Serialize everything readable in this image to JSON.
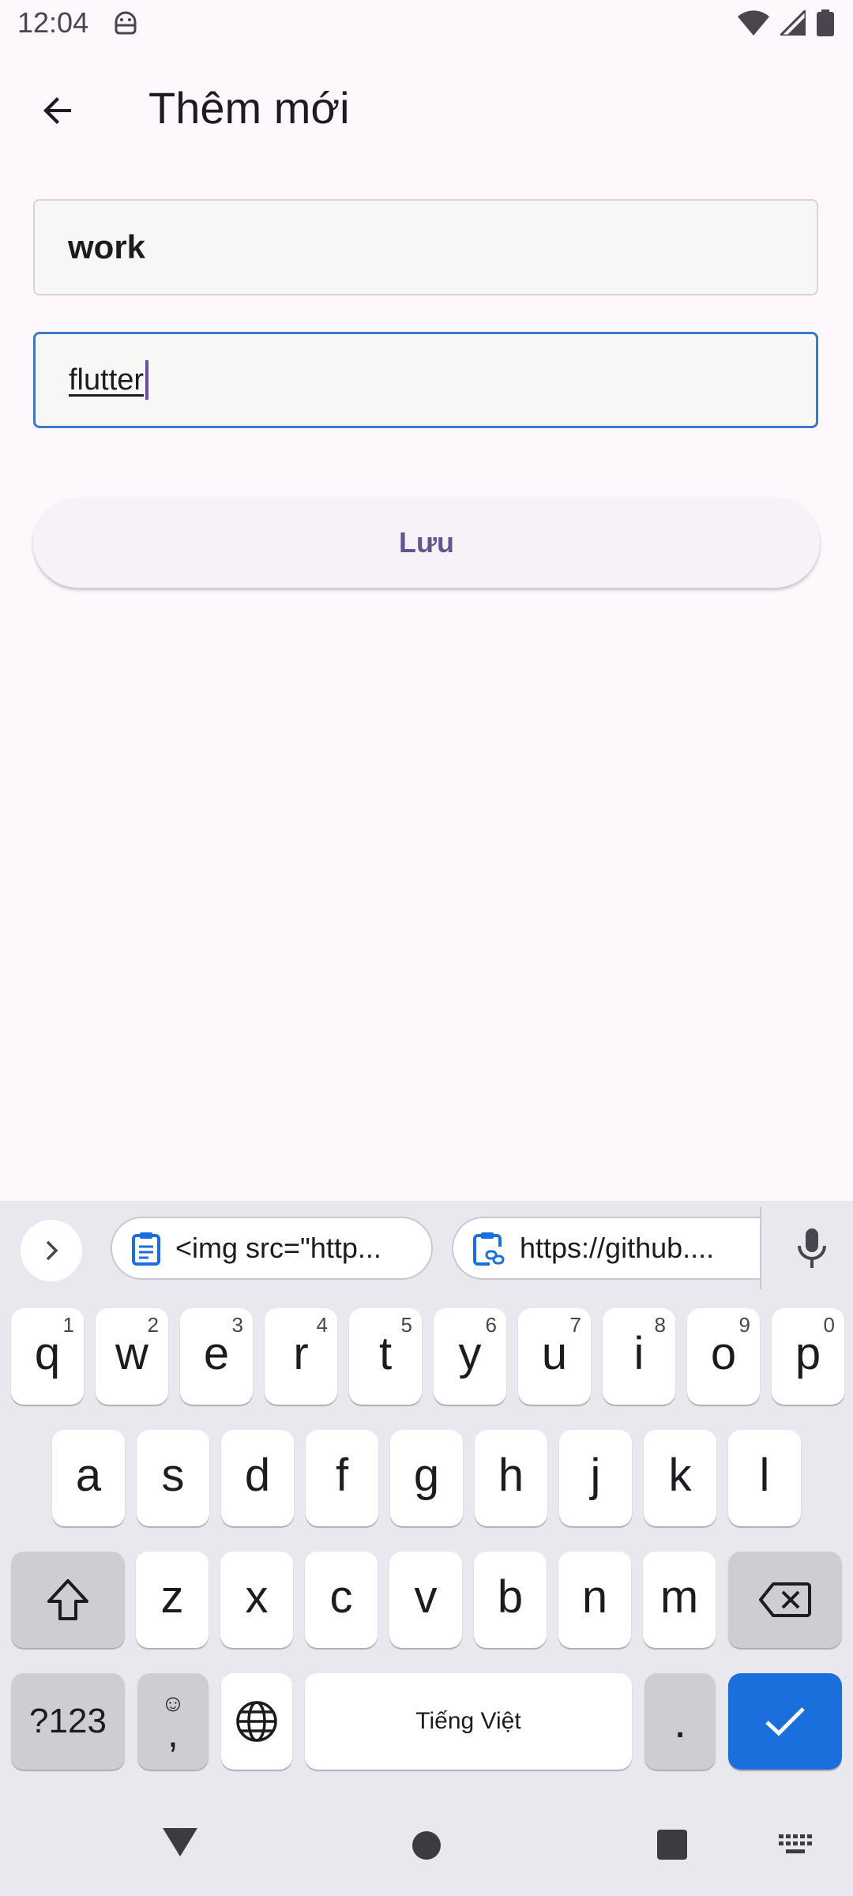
{
  "status_bar": {
    "time": "12:04",
    "icons": [
      "android-icon",
      "wifi-icon",
      "signal-icon",
      "battery-icon"
    ]
  },
  "app_bar": {
    "title": "Thêm mới",
    "back_icon": "arrow-back-icon"
  },
  "form": {
    "field1_value": "work",
    "field2_value": "flutter",
    "save_label": "Lưu"
  },
  "keyboard": {
    "suggestions": [
      {
        "icon": "clipboard-icon",
        "text": "<img src=\"http..."
      },
      {
        "icon": "clipboard-link-icon",
        "text": "https://github...."
      }
    ],
    "row1": [
      {
        "k": "q",
        "h": "1"
      },
      {
        "k": "w",
        "h": "2"
      },
      {
        "k": "e",
        "h": "3"
      },
      {
        "k": "r",
        "h": "4"
      },
      {
        "k": "t",
        "h": "5"
      },
      {
        "k": "y",
        "h": "6"
      },
      {
        "k": "u",
        "h": "7"
      },
      {
        "k": "i",
        "h": "8"
      },
      {
        "k": "o",
        "h": "9"
      },
      {
        "k": "p",
        "h": "0"
      }
    ],
    "row2": [
      "a",
      "s",
      "d",
      "f",
      "g",
      "h",
      "j",
      "k",
      "l"
    ],
    "row3": [
      "z",
      "x",
      "c",
      "v",
      "b",
      "n",
      "m"
    ],
    "symbols_label": "?123",
    "emoji_label": "☺",
    "comma_label": ",",
    "space_label": "Tiếng Việt",
    "period_label": "."
  },
  "colors": {
    "background": "#fef7fc",
    "accent": "#65558f",
    "focus_border": "#3b79c9",
    "enter_key": "#1b6fdc",
    "keyboard_bg": "#e9e8ee"
  }
}
